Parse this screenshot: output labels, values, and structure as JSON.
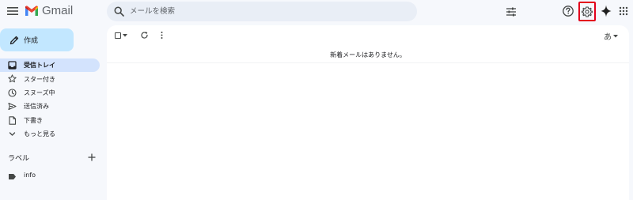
{
  "header": {
    "logo_text": "Gmail",
    "search_placeholder": "メールを検索"
  },
  "sidebar": {
    "compose_label": "作成",
    "items": [
      {
        "label": "受信トレイ",
        "icon": "inbox-icon",
        "active": true
      },
      {
        "label": "スター付き",
        "icon": "star-icon",
        "active": false
      },
      {
        "label": "スヌーズ中",
        "icon": "clock-icon",
        "active": false
      },
      {
        "label": "送信済み",
        "icon": "send-icon",
        "active": false
      },
      {
        "label": "下書き",
        "icon": "draft-icon",
        "active": false
      },
      {
        "label": "もっと見る",
        "icon": "chevron-down-icon",
        "active": false
      }
    ],
    "labels_title": "ラベル",
    "labels": [
      {
        "label": "info",
        "icon": "label-tag-icon"
      }
    ]
  },
  "main": {
    "input_mode": "あ",
    "empty_message": "新着メールはありません。"
  },
  "colors": {
    "background": "#f6f8fc",
    "compose": "#c2e7ff",
    "active_nav": "#d3e3fd",
    "highlight_box": "#e3001b",
    "gmail_red": "#ea4335",
    "gmail_blue": "#4285f4",
    "gmail_green": "#34a853",
    "gmail_yellow": "#fbbc04"
  }
}
